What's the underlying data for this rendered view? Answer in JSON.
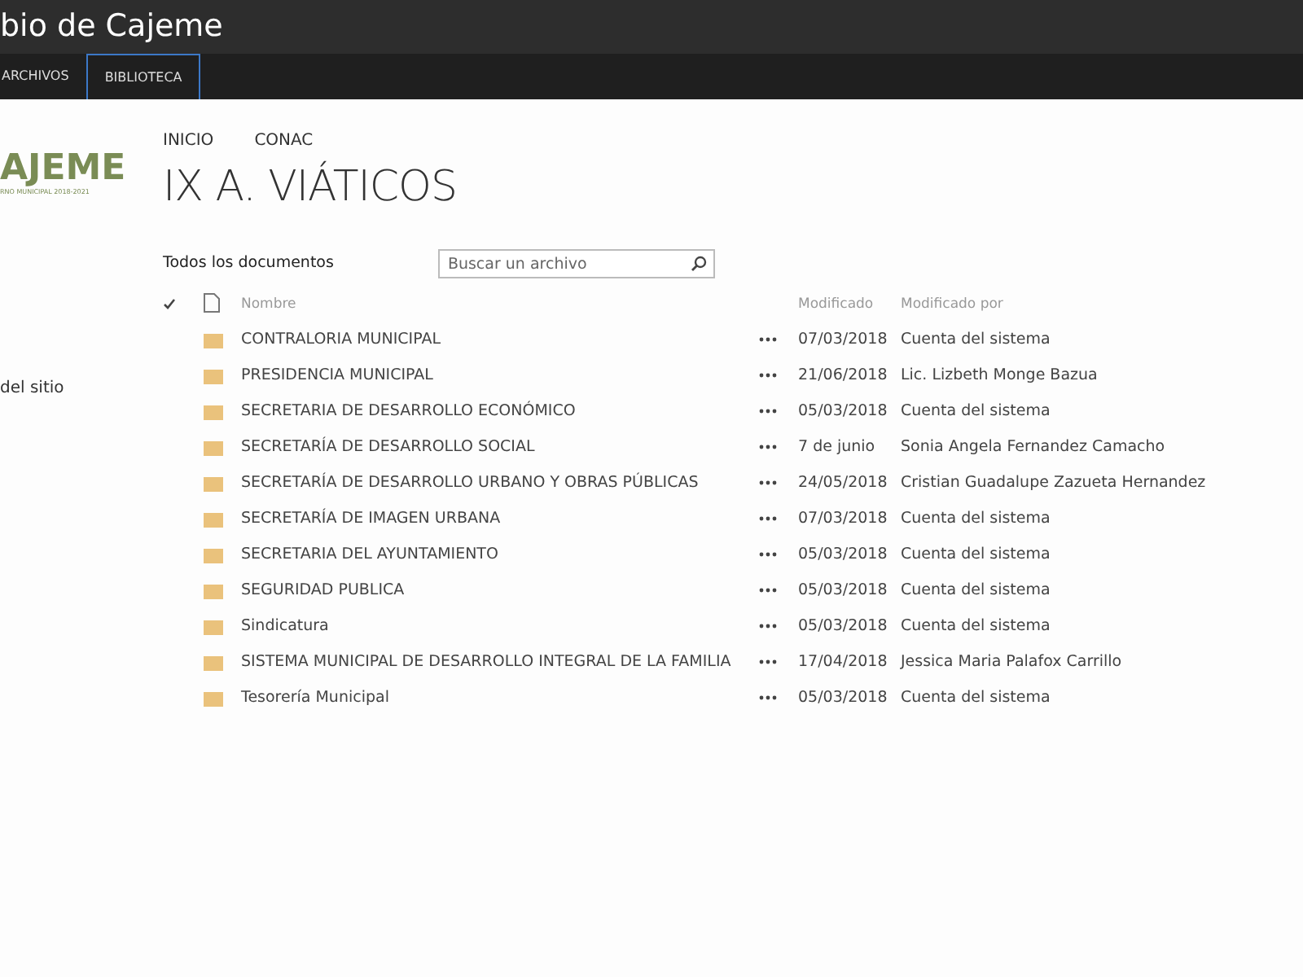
{
  "site_title": "bio de Cajeme",
  "tabs": [
    {
      "label": "ARCHIVOS",
      "selected": false
    },
    {
      "label": "BIBLIOTECA",
      "selected": true
    }
  ],
  "logo": {
    "text": "AJEME",
    "subtitle": "RNO MUNICIPAL 2018-2021"
  },
  "sidebar": {
    "items": [
      "del sitio"
    ]
  },
  "breadcrumb": [
    "INICIO",
    "CONAC"
  ],
  "page_title": "IX A. VIÁTICOS",
  "view": "Todos los documentos",
  "search": {
    "placeholder": "Buscar un archivo"
  },
  "table": {
    "columns": [
      "Nombre",
      "Modificado",
      "Modificado por"
    ],
    "rows": [
      {
        "name": "CONTRALORIA MUNICIPAL",
        "modified": "07/03/2018",
        "modified_by": "Cuenta del sistema"
      },
      {
        "name": "PRESIDENCIA MUNICIPAL",
        "modified": "21/06/2018",
        "modified_by": "Lic. Lizbeth Monge Bazua"
      },
      {
        "name": "SECRETARIA DE DESARROLLO ECONÓMICO",
        "modified": "05/03/2018",
        "modified_by": "Cuenta del sistema"
      },
      {
        "name": "SECRETARÍA DE DESARROLLO SOCIAL",
        "modified": "7 de junio",
        "modified_by": "Sonia Angela Fernandez Camacho"
      },
      {
        "name": "SECRETARÍA DE DESARROLLO URBANO Y OBRAS PÚBLICAS",
        "modified": "24/05/2018",
        "modified_by": "Cristian Guadalupe Zazueta Hernandez"
      },
      {
        "name": "SECRETARÍA DE IMAGEN URBANA",
        "modified": "07/03/2018",
        "modified_by": "Cuenta del sistema"
      },
      {
        "name": "SECRETARIA DEL AYUNTAMIENTO",
        "modified": "05/03/2018",
        "modified_by": "Cuenta del sistema"
      },
      {
        "name": "SEGURIDAD PUBLICA",
        "modified": "05/03/2018",
        "modified_by": "Cuenta del sistema"
      },
      {
        "name": "Sindicatura",
        "modified": "05/03/2018",
        "modified_by": "Cuenta del sistema"
      },
      {
        "name": "SISTEMA MUNICIPAL DE DESARROLLO INTEGRAL DE LA FAMILIA",
        "modified": "17/04/2018",
        "modified_by": "Jessica Maria Palafox Carrillo"
      },
      {
        "name": "Tesorería Municipal",
        "modified": "05/03/2018",
        "modified_by": "Cuenta del sistema"
      }
    ]
  }
}
